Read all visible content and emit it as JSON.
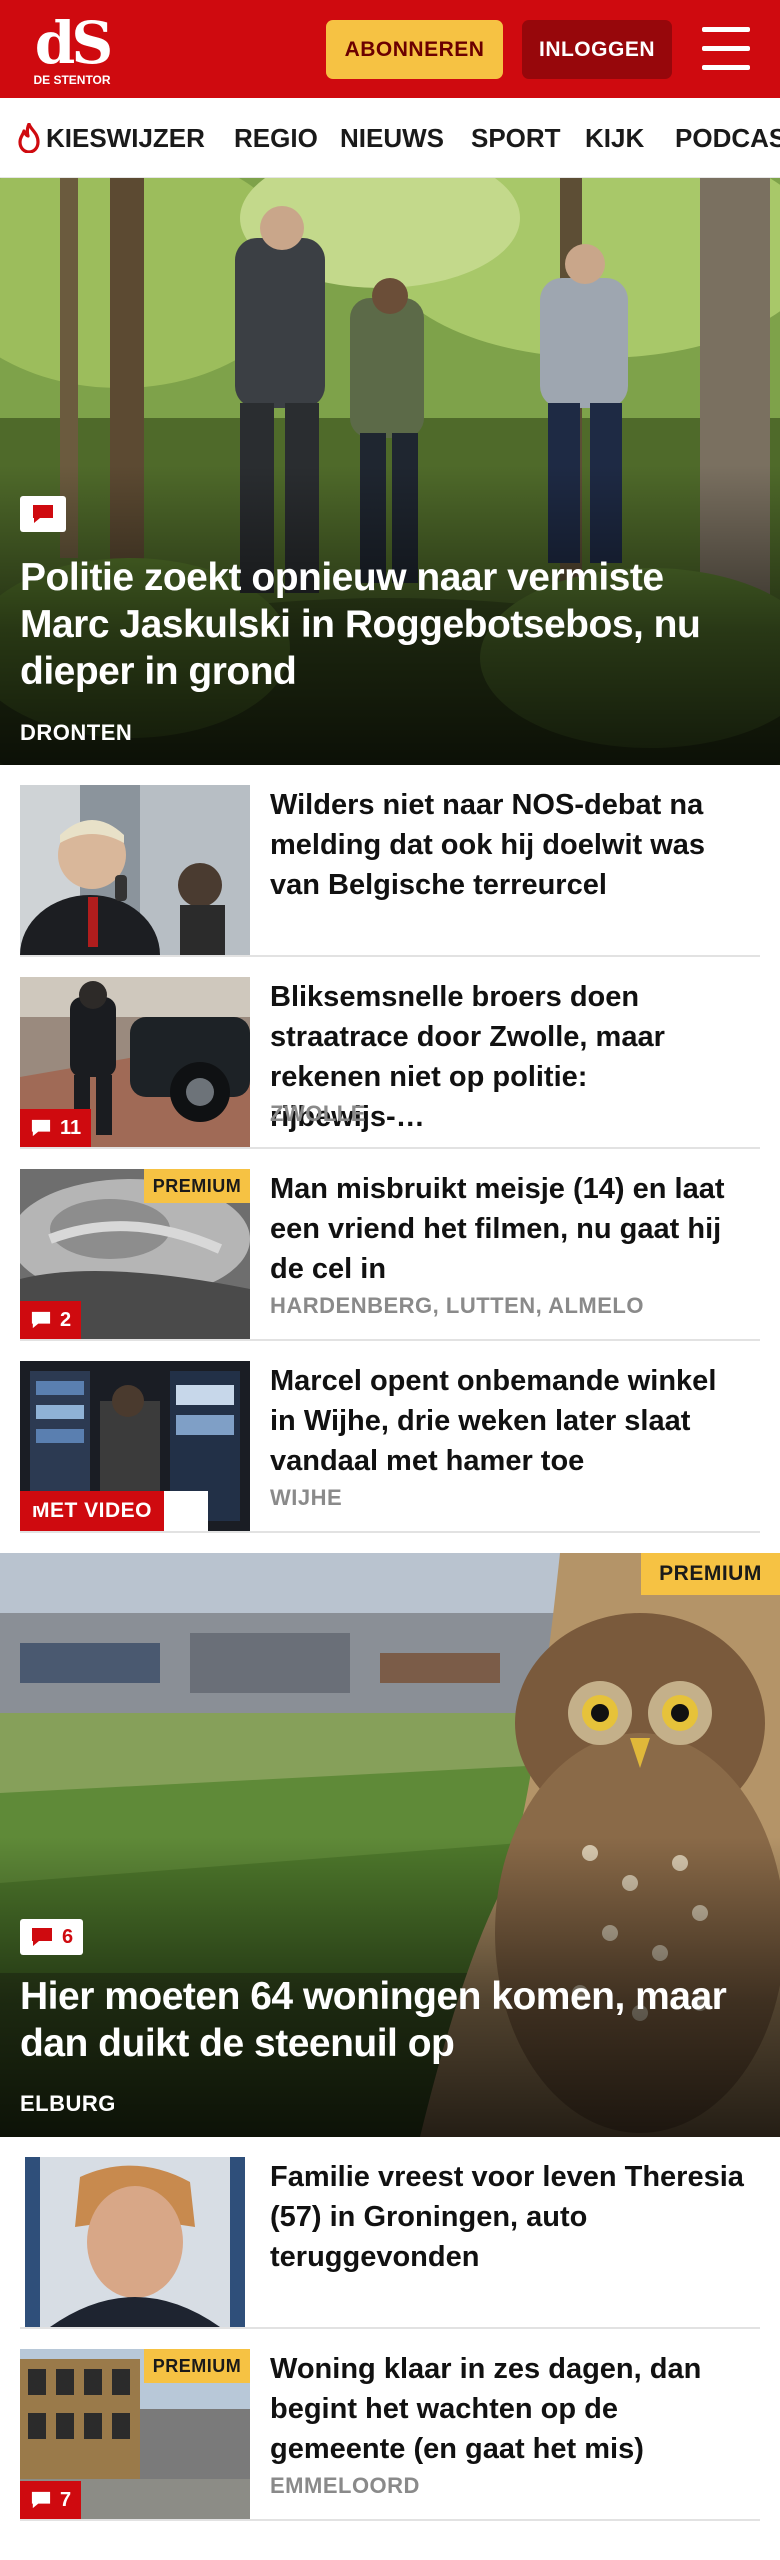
{
  "header": {
    "logo_mark": "dS",
    "logo_text": "DE STENTOR",
    "subscribe_label": "ABONNEREN",
    "login_label": "INLOGGEN",
    "menu_icon": "hamburger-icon",
    "brand_color": "#cf0a0f",
    "accent_color": "#f6c243"
  },
  "nav": {
    "items": [
      {
        "label": "KIESWIJZER",
        "icon": "flame-icon"
      },
      {
        "label": "REGIO"
      },
      {
        "label": "NIEUWS"
      },
      {
        "label": "SPORT"
      },
      {
        "label": "KIJK"
      },
      {
        "label": "PODCAST"
      }
    ]
  },
  "hero": {
    "comment_icon": "comment-icon",
    "title": "Politie zoekt opnieuw naar vermiste Marc Jaskulski in Roggebotsebos, nu dieper in grond",
    "place": "DRONTEN"
  },
  "articles": [
    {
      "title": "Wilders niet naar NOS-debat na melding dat ook hij doelwit was van Belgische terreurcel",
      "place": ""
    },
    {
      "title": "Bliksemsnelle broers doen straatrace door Zwolle, maar rekenen niet op politie: rijbewijs-…",
      "place": "ZWOLLE",
      "comments": "11"
    },
    {
      "title": "Man misbruikt meisje (14) en laat een vriend het filmen, nu gaat hij de cel in",
      "place": "HARDENBERG, LUTTEN, ALMELO",
      "comments": "2",
      "premium": "PREMIUM"
    },
    {
      "title": "Marcel opent onbemande winkel in Wijhe, drie weken later slaat vandaal met hamer toe",
      "place": "WIJHE",
      "video": "MET VIDEO"
    }
  ],
  "hero2": {
    "premium": "PREMIUM",
    "comments": "6",
    "title": "Hier moeten 64 woningen komen, maar dan duikt de steenuil op",
    "place": "ELBURG"
  },
  "articles2": [
    {
      "title": "Familie vreest voor leven Theresia (57) in Groningen, auto teruggevonden",
      "place": ""
    },
    {
      "title": "Woning klaar in zes dagen, dan begint het wachten op de gemeente (en gaat het mis)",
      "place": "EMMELOORD",
      "comments": "7",
      "premium": "PREMIUM"
    }
  ]
}
